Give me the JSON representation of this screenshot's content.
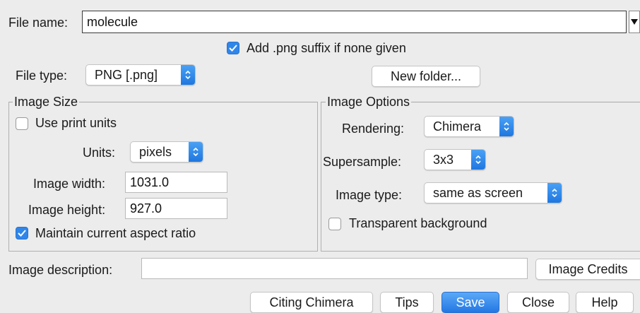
{
  "file_name": {
    "label": "File name:",
    "value": "molecule"
  },
  "add_suffix": {
    "label": "Add .png suffix if none given",
    "checked": true
  },
  "file_type": {
    "label": "File type:",
    "selected": "PNG [.png]"
  },
  "new_folder_label": "New folder...",
  "image_size": {
    "title": "Image Size",
    "use_print_units": {
      "label": "Use print units",
      "checked": false
    },
    "units": {
      "label": "Units:",
      "selected": "pixels"
    },
    "width": {
      "label": "Image width:",
      "value": "1031.0"
    },
    "height": {
      "label": "Image height:",
      "value": "927.0"
    },
    "maintain_aspect": {
      "label": "Maintain current aspect ratio",
      "checked": true
    }
  },
  "image_options": {
    "title": "Image Options",
    "rendering": {
      "label": "Rendering:",
      "selected": "Chimera"
    },
    "supersample": {
      "label": "Supersample:",
      "selected": "3x3"
    },
    "image_type": {
      "label": "Image type:",
      "selected": "same as screen"
    },
    "transparent_bg": {
      "label": "Transparent background",
      "checked": false
    }
  },
  "description": {
    "label": "Image description:",
    "value": ""
  },
  "image_credits_label": "Image Credits",
  "buttons": {
    "citing": "Citing Chimera",
    "tips": "Tips",
    "save": "Save",
    "close": "Close",
    "help": "Help"
  },
  "colors": {
    "accent": "#2f86ea",
    "background": "#ececec"
  }
}
